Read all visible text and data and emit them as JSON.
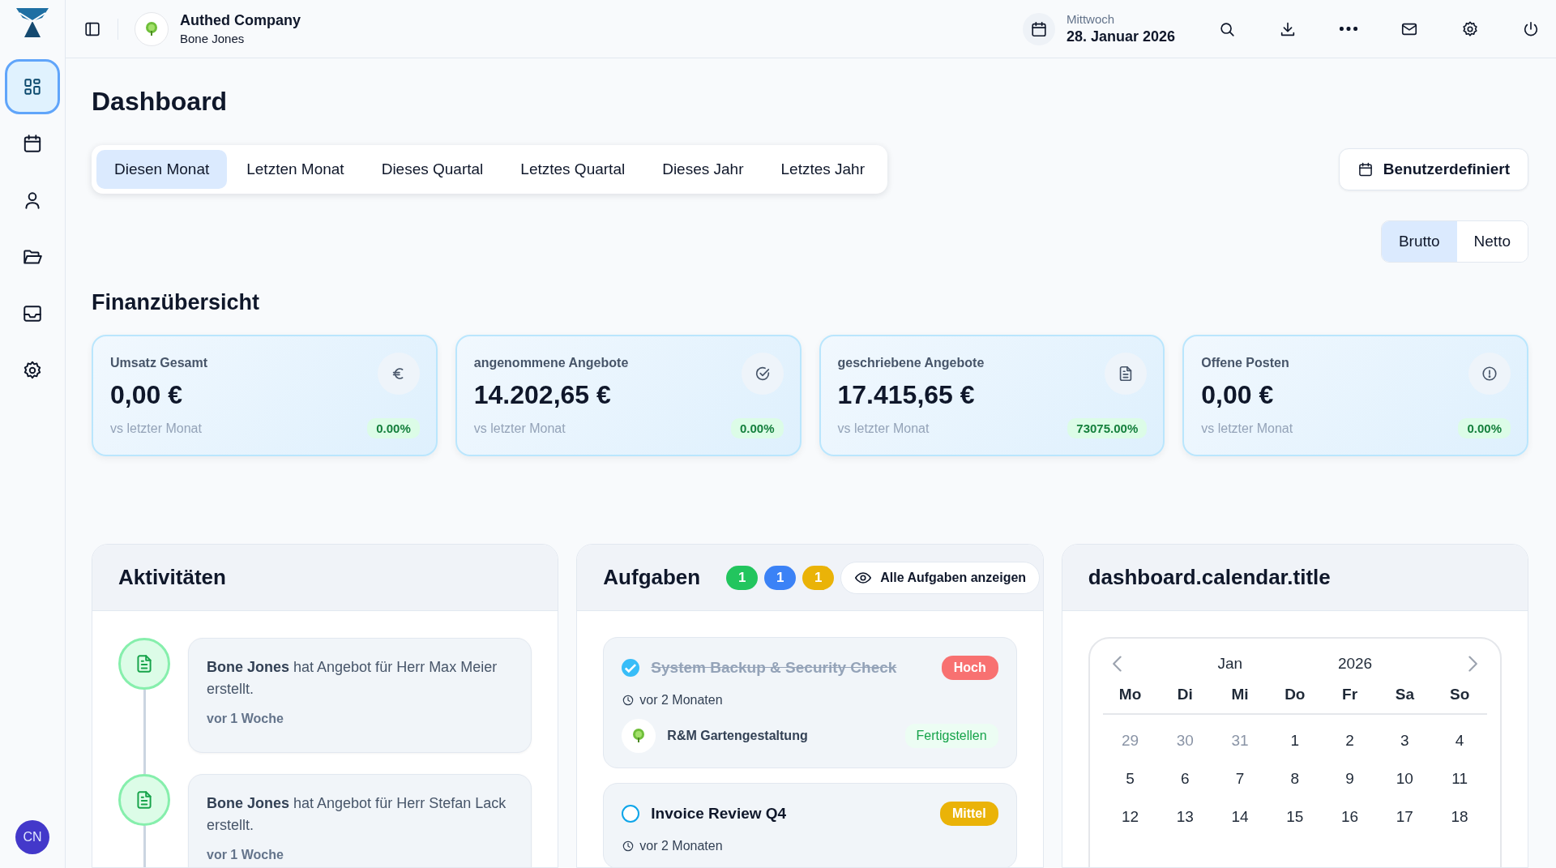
{
  "sidebar": {
    "items": [
      {
        "selected": true
      },
      {
        "selected": false
      },
      {
        "selected": false
      },
      {
        "selected": false
      },
      {
        "selected": false
      },
      {
        "selected": false
      }
    ],
    "avatar": "CN"
  },
  "header": {
    "company": "Authed Company",
    "user": "Bone Jones",
    "weekday": "Mittwoch",
    "date": "28. Januar 2026"
  },
  "page_title": "Dashboard",
  "period_tabs": [
    {
      "label": "Diesen Monat",
      "selected": true
    },
    {
      "label": "Letzten Monat",
      "selected": false
    },
    {
      "label": "Dieses Quartal",
      "selected": false
    },
    {
      "label": "Letztes Quartal",
      "selected": false
    },
    {
      "label": "Dieses Jahr",
      "selected": false
    },
    {
      "label": "Letztes Jahr",
      "selected": false
    }
  ],
  "custom_button": "Benutzerdefiniert",
  "tax_toggle": [
    {
      "label": "Brutto",
      "selected": true
    },
    {
      "label": "Netto",
      "selected": false
    }
  ],
  "finance": {
    "title": "Finanzübersicht",
    "cards": [
      {
        "label": "Umsatz Gesamt",
        "value": "0,00 €",
        "comparison": "vs letzter Monat",
        "change": "0.00%"
      },
      {
        "label": "angenommene Angebote",
        "value": "14.202,65 €",
        "comparison": "vs letzter Monat",
        "change": "0.00%"
      },
      {
        "label": "geschriebene Angebote",
        "value": "17.415,65 €",
        "comparison": "vs letzter Monat",
        "change": "73075.00%"
      },
      {
        "label": "Offene Posten",
        "value": "0,00 €",
        "comparison": "vs letzter Monat",
        "change": "0.00%"
      }
    ]
  },
  "activities": {
    "title": "Aktivitäten",
    "items": [
      {
        "text": "**Bone Jones** hat Angebot für Herr Max Meier erstellt.",
        "time": "vor 1 Woche"
      },
      {
        "text": "**Bone Jones** hat Angebot für Herr Stefan Lack erstellt.",
        "time": "vor 1 Woche"
      }
    ]
  },
  "tasks": {
    "title": "Aufgaben",
    "counts": [
      {
        "count": "1",
        "color": "#22c55e"
      },
      {
        "count": "1",
        "color": "#3b82f6"
      },
      {
        "count": "1",
        "color": "#eab308"
      }
    ],
    "show_all": "Alle Aufgaben anzeigen",
    "items": [
      {
        "title": "System Backup & Security Check",
        "checked": true,
        "priority": "Hoch",
        "color": "#f87171",
        "time": "vor 2 Monaten",
        "client": "R&M Gartengestaltung",
        "action": "Fertigstellen"
      },
      {
        "title": "Invoice Review Q4",
        "checked": false,
        "priority": "Mittel",
        "color": "#eab308",
        "time": "vor 2 Monaten"
      }
    ]
  },
  "calendar": {
    "title": "dashboard.calendar.title",
    "month": "Jan",
    "year": "2026",
    "weekdays": [
      "Mo",
      "Di",
      "Mi",
      "Do",
      "Fr",
      "Sa",
      "So"
    ],
    "weeks": [
      [
        {
          "day": "29",
          "outside": true
        },
        {
          "day": "30",
          "outside": true
        },
        {
          "day": "31",
          "outside": true
        },
        {
          "day": "1",
          "outside": false
        },
        {
          "day": "2",
          "outside": false
        },
        {
          "day": "3",
          "outside": false
        },
        {
          "day": "4",
          "outside": false
        }
      ],
      [
        {
          "day": "5",
          "outside": false
        },
        {
          "day": "6",
          "outside": false
        },
        {
          "day": "7",
          "outside": false
        },
        {
          "day": "8",
          "outside": false
        },
        {
          "day": "9",
          "outside": false
        },
        {
          "day": "10",
          "outside": false
        },
        {
          "day": "11",
          "outside": false
        }
      ],
      [
        {
          "day": "12",
          "outside": false
        },
        {
          "day": "13",
          "outside": false
        },
        {
          "day": "14",
          "outside": false
        },
        {
          "day": "15",
          "outside": false
        },
        {
          "day": "16",
          "outside": false
        },
        {
          "day": "17",
          "outside": false
        },
        {
          "day": "18",
          "outside": false
        }
      ]
    ]
  }
}
